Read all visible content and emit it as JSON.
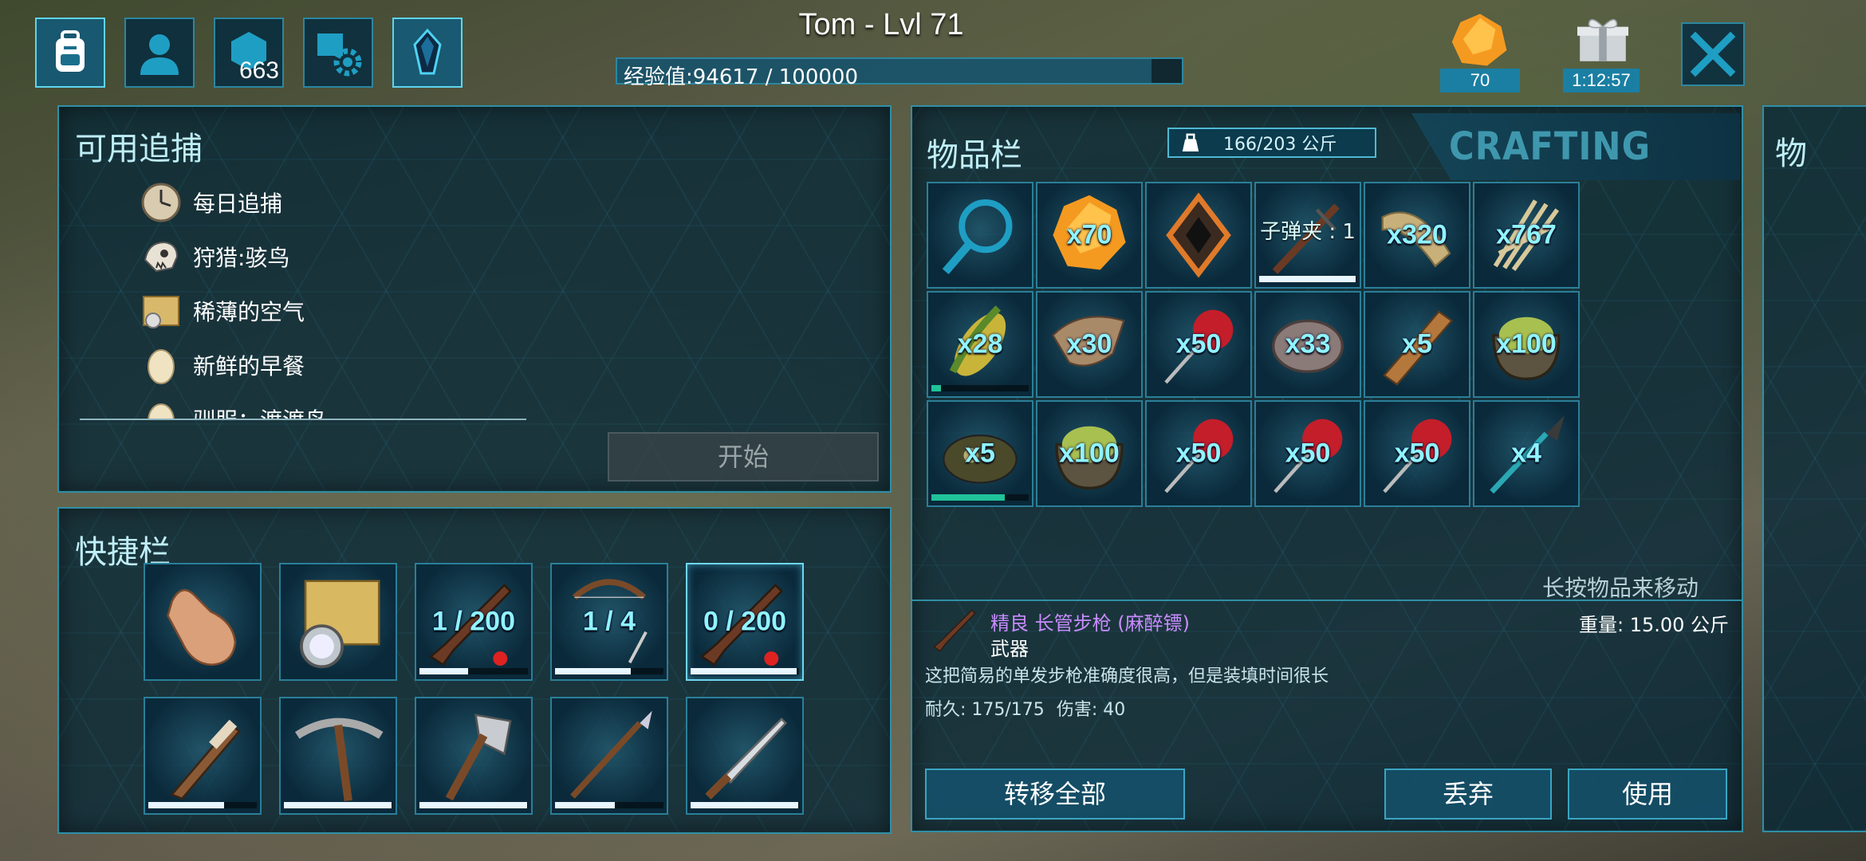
{
  "header": {
    "player_name": "Tom - Lvl 71",
    "xp_text": "经验值:94617 / 100000",
    "xp_progress": 0.946,
    "engram_points": "663",
    "element_count": "70",
    "gift_timer": "1:12:57"
  },
  "top_buttons": [
    {
      "icon": "backpack-icon",
      "active": true
    },
    {
      "icon": "character-icon",
      "active": false
    },
    {
      "icon": "engram-hex-icon",
      "active": false
    },
    {
      "icon": "settings-book-icon",
      "active": false
    },
    {
      "icon": "crystal-icon",
      "active": true
    }
  ],
  "hunts": {
    "title": "可用追捕",
    "items": [
      {
        "label": "每日追捕",
        "icon": "clock-icon"
      },
      {
        "label": "狩猎:骇鸟",
        "icon": "skull-icon"
      },
      {
        "label": "稀薄的空气",
        "icon": "map-icon"
      },
      {
        "label": "新鲜的早餐",
        "icon": "egg-icon"
      },
      {
        "label": "驯服：渡渡鸟",
        "icon": "egg-icon"
      }
    ],
    "start_label": "开始"
  },
  "hotbar": {
    "title": "快捷栏",
    "row1": [
      {
        "icon": "hand-icon",
        "text": "",
        "bar": null
      },
      {
        "icon": "map-compass-icon",
        "text": "",
        "bar": null
      },
      {
        "icon": "rifle-icon",
        "text": "1 / 200",
        "bar": 0.45
      },
      {
        "icon": "bow-icon",
        "text": "1 / 4",
        "bar": 0.7
      },
      {
        "icon": "rifle-icon",
        "text": "0 / 200",
        "bar": 0.98
      }
    ],
    "row2": [
      {
        "icon": "torch-icon",
        "bar": 0.7
      },
      {
        "icon": "pickaxe-icon",
        "bar": 0.99
      },
      {
        "icon": "hatchet-icon",
        "bar": 0.99
      },
      {
        "icon": "spear-icon",
        "bar": 0.55
      },
      {
        "icon": "sword-icon",
        "bar": 0.99
      }
    ]
  },
  "inventory": {
    "title": "物品栏",
    "weight": "166/203 公斤",
    "crafting_tab": "CRAFTING",
    "peek_title": "物",
    "items": [
      {
        "icon": "search-icon",
        "qty": "",
        "bar": null
      },
      {
        "icon": "element-shard-icon",
        "qty": "x70",
        "bar": null
      },
      {
        "icon": "implant-icon",
        "qty": "",
        "bar": null
      },
      {
        "icon": "crossbow-icon",
        "qty": "",
        "bar": 0.99,
        "ammo": "子弹夹 : 1"
      },
      {
        "icon": "fiber-icon",
        "qty": "x320",
        "bar": null
      },
      {
        "icon": "thatch-icon",
        "qty": "x767",
        "bar": null
      },
      {
        "icon": "corn-icon",
        "qty": "x28",
        "bar": 0.1,
        "bar_color": "green"
      },
      {
        "icon": "hide-icon",
        "qty": "x30",
        "bar": null
      },
      {
        "icon": "dart-icon",
        "qty": "x50",
        "bar": null
      },
      {
        "icon": "stone-icon",
        "qty": "x33",
        "bar": null
      },
      {
        "icon": "wood-icon",
        "qty": "x5",
        "bar": null
      },
      {
        "icon": "seed-pot-icon",
        "qty": "x100",
        "bar": null
      },
      {
        "icon": "meat-icon",
        "qty": "x5",
        "bar": 0.75,
        "bar_color": "green"
      },
      {
        "icon": "seed-pot-icon",
        "qty": "x100",
        "bar": null
      },
      {
        "icon": "dart-icon",
        "qty": "x50",
        "bar": null
      },
      {
        "icon": "dart-icon",
        "qty": "x50",
        "bar": null
      },
      {
        "icon": "dart-icon",
        "qty": "x50",
        "bar": null
      },
      {
        "icon": "spear-tip-icon",
        "qty": "x4",
        "bar": null
      }
    ],
    "hint": "长按物品来移动",
    "detail": {
      "name": "精良 长管步枪 (麻醉镖)",
      "type": "武器",
      "weight": "重量: 15.00 公斤",
      "description": "这把简易的单发步枪准确度很高，但是装填时间很长",
      "durability": "耐久: 175/175",
      "damage": "伤害: 40"
    },
    "buttons": {
      "transfer_all": "转移全部",
      "drop": "丢弃",
      "use": "使用"
    }
  },
  "colors": {
    "accent": "#2f8fa6",
    "qty_text": "#8ff4ff",
    "rarity_fine": "#c88cff",
    "hp_bar": "#20c39a"
  }
}
